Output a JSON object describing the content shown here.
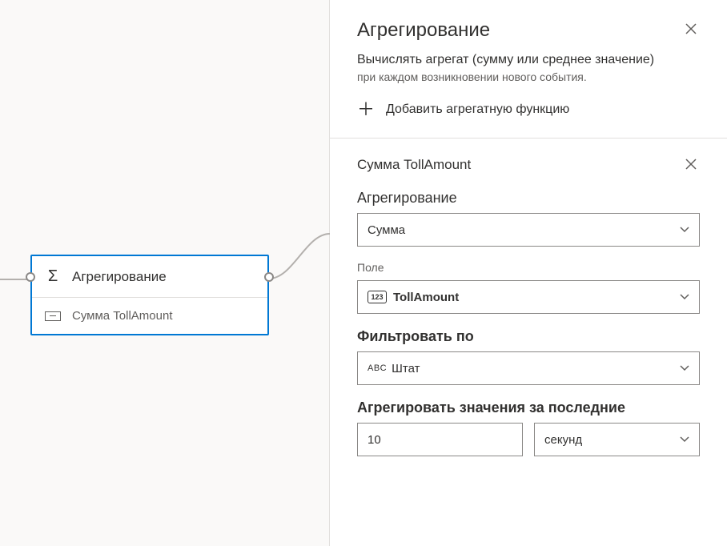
{
  "canvas": {
    "node_title": "Агрегирование",
    "node_item": "Сумма TollAmount"
  },
  "panel": {
    "title": "Агрегирование",
    "desc_main": "Вычислять агрегат (сумму или среднее значение)",
    "desc_sub": "при каждом возникновении нового события.",
    "add_label": "Добавить агрегатную функцию",
    "section_title": "Сумма TollAmount",
    "agg_label": "Агрегирование",
    "agg_value": "Сумма",
    "field_label": "Поле",
    "field_icon_text": "123",
    "field_value": "TollAmount",
    "filter_label": "Фильтровать по",
    "filter_prefix": "ABC",
    "filter_value": "Штат",
    "window_label": "Агрегировать значения за последние",
    "window_value": "10",
    "window_unit": "секунд"
  }
}
